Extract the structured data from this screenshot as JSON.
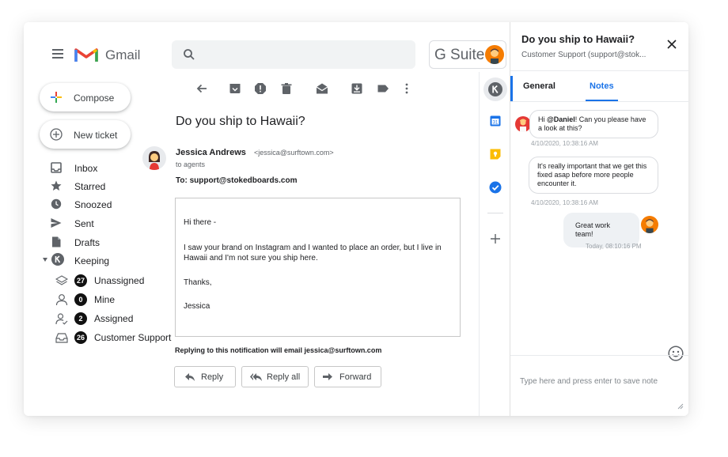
{
  "app": {
    "title": "Gmail",
    "gsuite": "G Suite"
  },
  "search": {
    "placeholder": ""
  },
  "nav": {
    "compose": "Compose",
    "new_ticket": "New ticket",
    "items": [
      {
        "label": "Inbox",
        "icon": "inbox-icon"
      },
      {
        "label": "Starred",
        "icon": "star-icon"
      },
      {
        "label": "Snoozed",
        "icon": "clock-icon"
      },
      {
        "label": "Sent",
        "icon": "send-icon"
      },
      {
        "label": "Drafts",
        "icon": "draft-icon"
      },
      {
        "label": "Keeping",
        "icon": "keeping-icon"
      }
    ],
    "sub_items": [
      {
        "label": "Unassigned",
        "count": "27",
        "icon": "layers-icon"
      },
      {
        "label": "Mine",
        "count": "0",
        "icon": "person-icon"
      },
      {
        "label": "Assigned",
        "count": "2",
        "icon": "assigned-icon"
      },
      {
        "label": "Customer Support",
        "count": "26",
        "icon": "tray-icon"
      }
    ]
  },
  "email": {
    "subject": "Do you ship to Hawaii?",
    "sender_name": "Jessica Andrews",
    "sender_email": "<jessica@surftown.com>",
    "to_agents": "to agents",
    "to_line": "To: support@stokedboards.com",
    "body": [
      "Hi there -",
      "I saw your brand on Instagram and I wanted to place an order, but I live in Hawaii and I'm not sure you ship here.",
      "Thanks,",
      "Jessica"
    ],
    "reply_note": "Replying to this notification will email jessica@surftown.com",
    "actions": {
      "reply": "Reply",
      "reply_all": "Reply all",
      "forward": "Forward"
    }
  },
  "panel": {
    "title": "Do you ship to Hawaii?",
    "subtitle": "Customer Support (support@stok...",
    "tabs": {
      "general": "General",
      "notes": "Notes"
    },
    "notes": [
      {
        "text_pre": "Hi ",
        "mention": "@Daniel",
        "text_post": "! Can you please have a look at this?",
        "time": "4/10/2020, 10:38:16 AM"
      },
      {
        "text": "It's really important that we get this fixed asap before more people encounter it.",
        "time": "4/10/2020, 10:38:16 AM"
      },
      {
        "text": "Great work team!",
        "time": "Today, 08:10:16 PM"
      }
    ],
    "input_placeholder": "Type here and press enter to save note"
  },
  "colors": {
    "accent": "#1a73e8",
    "gmail_red": "#ea4335",
    "orange_avatar": "#f57c00"
  }
}
